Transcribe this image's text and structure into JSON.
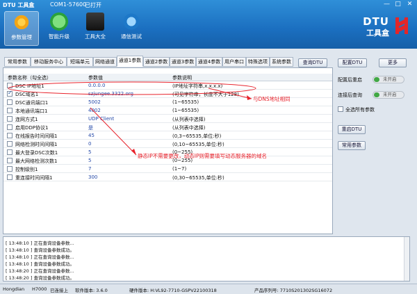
{
  "titlebar": {
    "app": "DTU 工具盒",
    "port": "COM1-57600",
    "state": "已打开",
    "min": "—",
    "max": "□",
    "close": "✕"
  },
  "toolbar": {
    "items": [
      {
        "label": "参数管理"
      },
      {
        "label": "智能升级"
      },
      {
        "label": "工具大全"
      },
      {
        "label": "通信测试"
      }
    ]
  },
  "brand": {
    "line1": "DTU",
    "line2": "工具盒"
  },
  "tabs": [
    "常用参数",
    "移动服务中心",
    "短端单元",
    "网络通道",
    "通道1参数",
    "通道2参数",
    "通道3参数",
    "通道4参数",
    "用户串口",
    "特殊选项",
    "系统参数"
  ],
  "buttons": {
    "query": "查询DTU",
    "config": "配置DTU",
    "more": "更多",
    "restart": "重启DTU",
    "common": "常用参数"
  },
  "table": {
    "col1": "参数名称（勾全选）",
    "col2": "参数值",
    "col3": "参数说明",
    "rows": [
      {
        "name": "DSC IP地址1",
        "value": "0.0.0.0",
        "desc": "(IP地址字符串,x.x.x.x)",
        "checked": false
      },
      {
        "name": "DSC域名1",
        "value": "szjungee.3322.org",
        "desc": "(可见字符串，长度不大于128)",
        "checked": true
      },
      {
        "name": "DSC通讯端口1",
        "value": "5002",
        "desc": "(1~65535)",
        "checked": false
      },
      {
        "name": "本地通讯端口1",
        "value": "4002",
        "desc": "(1~65535)",
        "checked": false
      },
      {
        "name": "连网方式1",
        "value": "UDP Client",
        "desc": "(从列表中选择)",
        "checked": false
      },
      {
        "name": "启用DDP协议1",
        "value": "是",
        "desc": "(从列表中选择)",
        "checked": false
      },
      {
        "name": "在线报告时间间隔1",
        "value": "45",
        "desc": "(0,3~65535,单位:秒)",
        "checked": false
      },
      {
        "name": "网络检测时间间隔1",
        "value": "0",
        "desc": "(0,10~65535,单位:秒)",
        "checked": false
      },
      {
        "name": "最大登录DSC次数1",
        "value": "5",
        "desc": "(0~255)",
        "checked": false
      },
      {
        "name": "最大网络检测次数1",
        "value": "5",
        "desc": "(0~255)",
        "checked": false
      },
      {
        "name": "控制级别1",
        "value": "7",
        "desc": "(1~7)",
        "checked": false
      },
      {
        "name": "重连接时间间隔1",
        "value": "300",
        "desc": "(0,30~65535,单位:秒)",
        "checked": false
      }
    ]
  },
  "side": {
    "restart_after_config": "配置后重启",
    "query_after_connect": "连接后查询",
    "show_all": "全选所有参数",
    "toggle_off": "未开启"
  },
  "annotations": {
    "a1": "与DNS地址相同",
    "a2": "静态IP不需要更改，动态IP则需要填写动态服务器的域名"
  },
  "log": [
    "[ 13:48:10 ] 正在查询设备参数...",
    "[ 13:48:10 ] 查询设备参数成功。",
    "[ 13:48:10 ] 正在查询设备参数...",
    "[ 13:48:10 ] 查询设备参数成功。",
    "[ 13:48:20 ] 正在查询设备参数...",
    "[ 13:48:20 ] 查询设备参数成功。"
  ],
  "status": {
    "vendor": "Hongdian",
    "model": "H7000",
    "conn": "已连接上",
    "sw": "软件版本: 3.6.0",
    "hw": "硬件版本: H:VL92-7710-GSPV22100318",
    "sn": "产品序列号: 7710S201302SG16072"
  },
  "colors": {
    "accent": "#1b6fc0",
    "annotation": "#e8222b"
  }
}
